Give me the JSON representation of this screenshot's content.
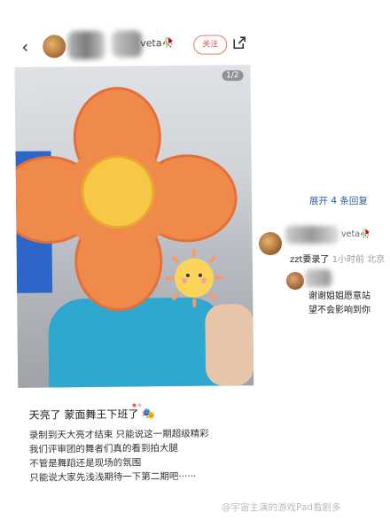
{
  "post": {
    "header": {
      "back_glyph": "‹",
      "username_suffix": "veta",
      "follow_label": "关注"
    },
    "photo_counter": "1/2",
    "title": "天亮了 蒙面舞王下班了",
    "title_emoji": "🎭",
    "body_lines": [
      "录制到天大亮才结束 只能说这一期超级精彩",
      "我们评审团的舞者们真的看到拍大腿",
      "不管是舞蹈还是现场的氛围",
      "只能说大家先浅浅期待一下第二期吧······"
    ]
  },
  "comments": {
    "expand_label": "展开 4 条回复",
    "top_comment": {
      "username_suffix": "veta",
      "text": "zzt要录了",
      "time": "1小时前 北京"
    },
    "reply_lines": [
      "谢谢姐姐愿意站",
      "望不会影响到你"
    ]
  },
  "watermark": "@宇宙主演的游戏Pad看剧多",
  "colors": {
    "follow_red": "#e44444",
    "link_blue": "#2a5fa8",
    "flower_orange": "#f08a4b",
    "flower_center": "#f7c845"
  }
}
